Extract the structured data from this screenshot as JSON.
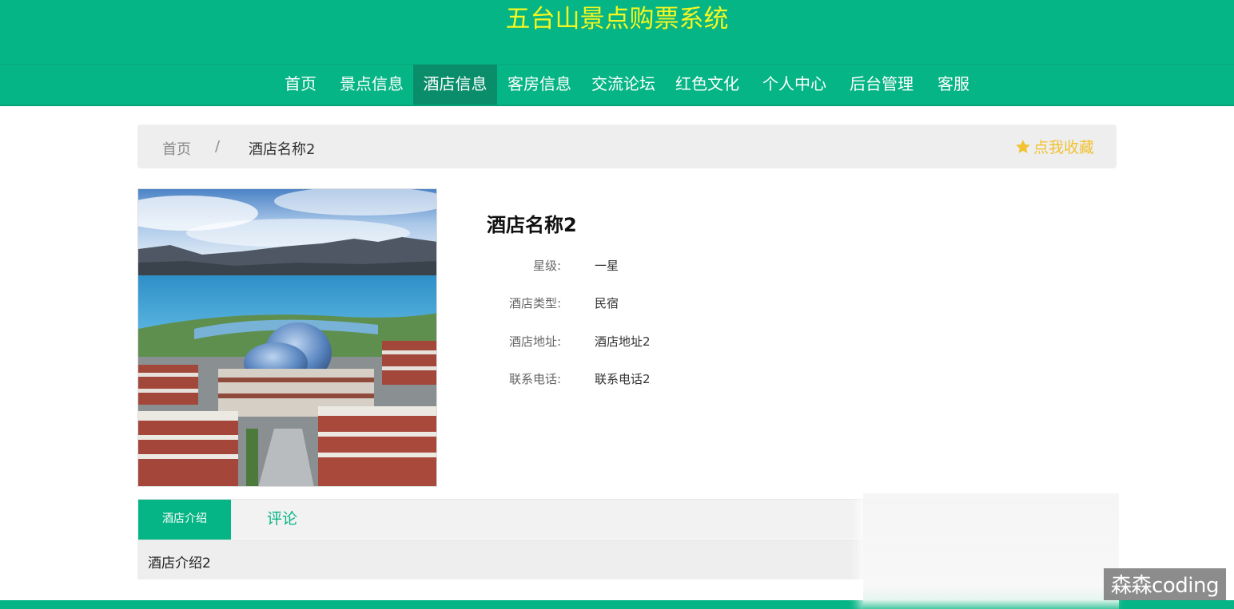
{
  "site": {
    "title": "五台山景点购票系统"
  },
  "nav": {
    "items": [
      {
        "label": "首页"
      },
      {
        "label": "景点信息"
      },
      {
        "label": "酒店信息"
      },
      {
        "label": "客房信息"
      },
      {
        "label": "交流论坛"
      },
      {
        "label": "红色文化"
      },
      {
        "label": "个人中心"
      },
      {
        "label": "后台管理"
      },
      {
        "label": "客服"
      }
    ],
    "active": "酒店信息"
  },
  "breadcrumb": {
    "home": "首页",
    "separator": "/",
    "current": "酒店名称2",
    "favorite_label": "点我收藏"
  },
  "hotel": {
    "name": "酒店名称2",
    "fields": [
      {
        "label": "星级:",
        "value": "一星"
      },
      {
        "label": "酒店类型:",
        "value": "民宿"
      },
      {
        "label": "酒店地址:",
        "value": "酒店地址2"
      },
      {
        "label": "联系电话:",
        "value": "联系电话2"
      }
    ]
  },
  "tabs": {
    "items": [
      {
        "label": "酒店介绍"
      },
      {
        "label": "评论"
      }
    ],
    "active": "酒店介绍",
    "content": "酒店介绍2"
  },
  "watermark": "森森coding",
  "colors": {
    "primary": "#05b585",
    "active_nav": "#0a8d6a",
    "title": "#f4f720",
    "favorite": "#f1c232"
  }
}
